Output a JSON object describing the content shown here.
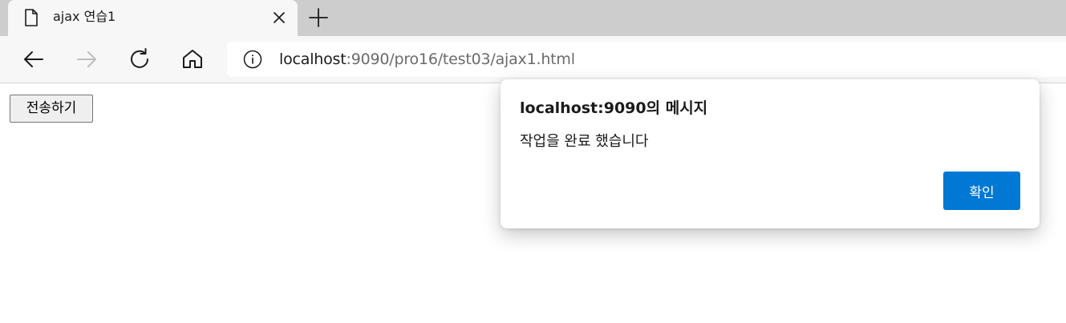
{
  "browser": {
    "tab": {
      "title": "ajax 연습1",
      "icon": "page-icon",
      "close_icon": "close-icon"
    },
    "new_tab_icon": "plus-icon",
    "toolbar": {
      "back_icon": "back-arrow-icon",
      "forward_icon": "forward-arrow-icon",
      "refresh_icon": "refresh-icon",
      "home_icon": "home-icon",
      "info_icon": "info-icon"
    },
    "address": {
      "host": "localhost",
      "rest": ":9090/pro16/test03/ajax1.html"
    }
  },
  "page": {
    "send_button_label": "전송하기"
  },
  "dialog": {
    "title": "localhost:9090의 메시지",
    "message": "작업을 완료 했습니다",
    "ok_label": "확인"
  },
  "colors": {
    "accent": "#0078d4",
    "tab_strip": "#cdcdcd",
    "toolbar": "#f7f7f7"
  }
}
